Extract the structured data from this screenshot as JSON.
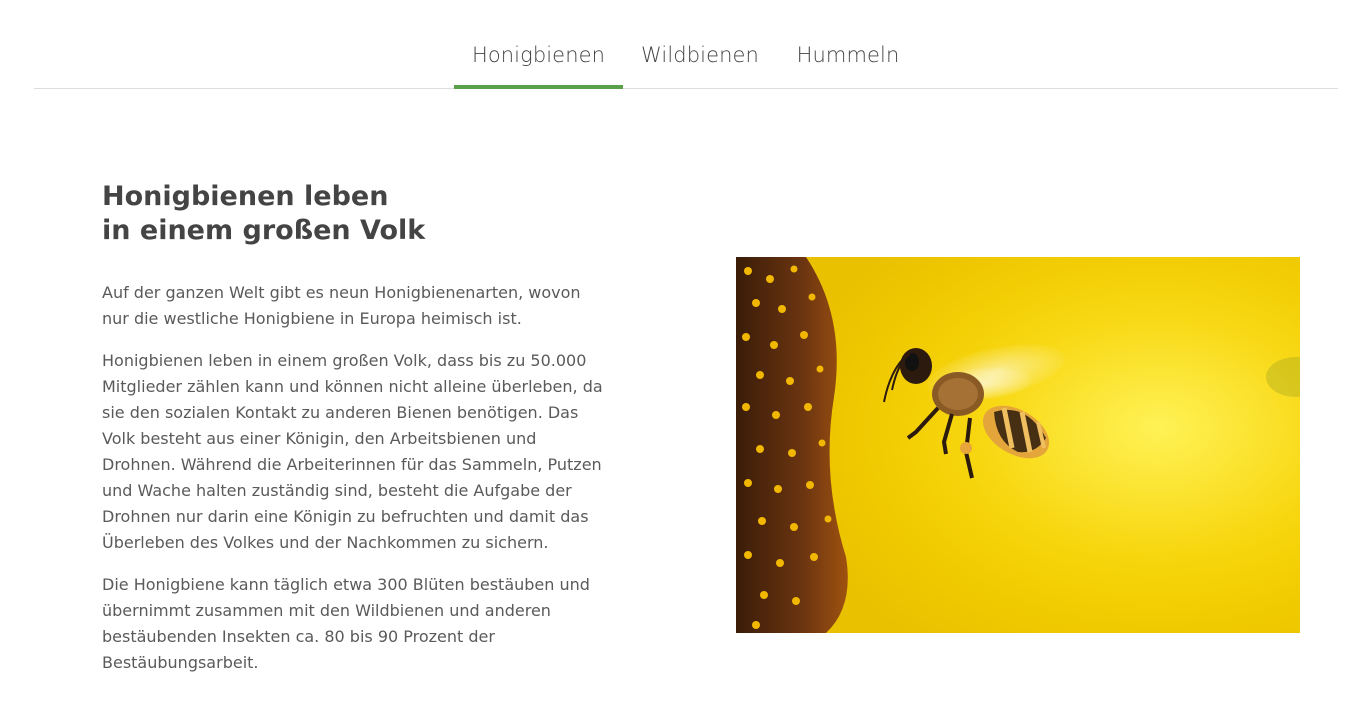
{
  "tabs": [
    {
      "label": "Honigbienen",
      "active": true
    },
    {
      "label": "Wildbienen",
      "active": false
    },
    {
      "label": "Hummeln",
      "active": false
    }
  ],
  "colors": {
    "accent": "#5aa04a",
    "text": "#555555",
    "heading": "#444444"
  },
  "content": {
    "title_line1": "Honigbienen leben",
    "title_line2": "in einem großen Volk",
    "paragraphs": [
      "Auf der ganzen Welt gibt es neun Honigbienenarten, wovon nur die westliche Honigbiene in Europa heimisch ist.",
      "Honigbienen leben in einem großen Volk, dass bis zu 50.000 Mitglieder zählen kann und können nicht alleine überleben, da sie den sozialen Kontakt zu anderen Bienen benötigen. Das Volk besteht aus einer Königin, den Arbeitsbienen und Drohnen. Während die Arbeiterinnen für das Sammeln, Putzen und Wache halten zuständig sind, besteht die Aufgabe der Drohnen nur darin eine Königin zu befruchten und damit das Überleben des Volkes und der Nachkommen zu sichern.",
      "Die Honigbiene kann täglich etwa 300 Blüten bestäuben und übernimmt zusammen mit den Wildbienen und anderen bestäubenden Insekten ca. 80 bis 90 Prozent der Bestäubungsarbeit."
    ]
  },
  "image": {
    "subject": "honeybee-on-sunflower"
  }
}
